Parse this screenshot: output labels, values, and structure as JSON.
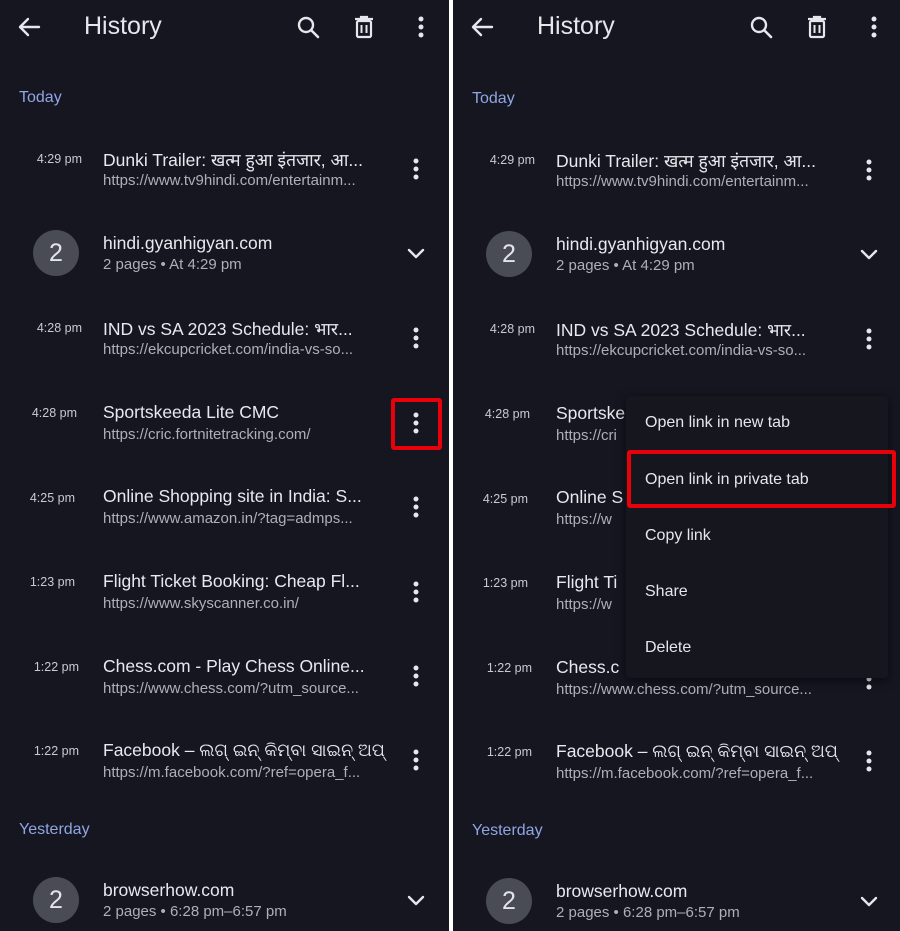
{
  "screen": {
    "title": "History",
    "back_icon": "back-arrow-icon",
    "toolbar_icons": [
      "search-icon",
      "delete-icon",
      "more-vertical-icon"
    ]
  },
  "sections": {
    "today": "Today",
    "yesterday": "Yesterday"
  },
  "entries": [
    {
      "time": "4:29 pm",
      "title": "Dunki Trailer: खत्म हुआ इंतजार, आ...",
      "url": "https://www.tv9hindi.com/entertainm..."
    },
    {
      "time": "4:28 pm",
      "title": "IND vs SA 2023 Schedule: भार...",
      "url": "https://ekcupcricket.com/india-vs-so..."
    },
    {
      "time": "4:28 pm",
      "title": "Sportskeeda Lite CMC",
      "url": "https://cric.fortnitetracking.com/"
    },
    {
      "time": "4:25 pm",
      "title": "Online Shopping site in India: S...",
      "url": "https://www.amazon.in/?tag=admps..."
    },
    {
      "time": "1:23 pm",
      "title": "Flight Ticket Booking: Cheap Fl...",
      "url": "https://www.skyscanner.co.in/"
    },
    {
      "time": "1:22 pm",
      "title": "Chess.com - Play Chess Online...",
      "url": "https://www.chess.com/?utm_source..."
    },
    {
      "time": "1:22 pm",
      "title": "Facebook – ଲଗ୍ ଇନ୍ କିମ୍ବା ସାଇନ୍ ଅପ୍",
      "url": "https://m.facebook.com/?ref=opera_f..."
    }
  ],
  "groups": [
    {
      "count": "2",
      "domain": "hindi.gyanhigyan.com",
      "summary": "2 pages • At 4:29 pm"
    },
    {
      "count": "2",
      "domain": "browserhow.com",
      "summary": "2 pages • 6:28 pm–6:57 pm"
    }
  ],
  "right_partial": {
    "sportskeeda_title": "Sportske",
    "sportskeeda_url": "https://cri",
    "online_title": "Online S",
    "online_url": "https://w",
    "flight_title": "Flight Ti",
    "flight_url": "https://w",
    "chess_title": "Chess.c"
  },
  "context_menu": {
    "items": [
      "Open link in new tab",
      "Open link in private tab",
      "Copy link",
      "Share",
      "Delete"
    ]
  },
  "highlight_color": "#e8000b"
}
